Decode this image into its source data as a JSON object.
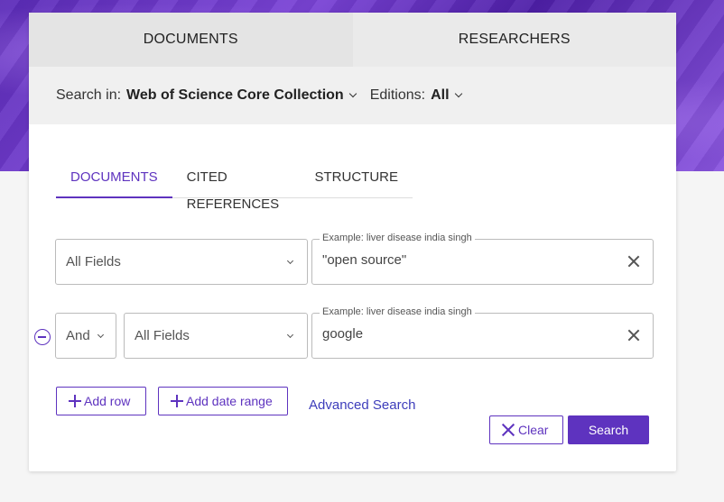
{
  "top_tabs": {
    "documents": "DOCUMENTS",
    "researchers": "RESEARCHERS"
  },
  "search_in": {
    "label": "Search in:",
    "value": "Web of Science Core Collection"
  },
  "editions": {
    "label": "Editions:",
    "value": "All"
  },
  "sub_tabs": {
    "documents": "DOCUMENTS",
    "cited_references": "CITED REFERENCES",
    "structure": "STRUCTURE"
  },
  "rows": [
    {
      "field": "All Fields",
      "placeholder": "Example: liver disease india singh",
      "value": "\"open source\""
    },
    {
      "operator": "And",
      "field": "All Fields",
      "placeholder": "Example: liver disease india singh",
      "value": "google"
    }
  ],
  "buttons": {
    "add_row": "Add row",
    "add_date_range": "Add date range",
    "advanced_search": "Advanced Search",
    "clear": "Clear",
    "search": "Search"
  },
  "colors": {
    "accent": "#5e33bf",
    "link": "#3d3dbb"
  }
}
